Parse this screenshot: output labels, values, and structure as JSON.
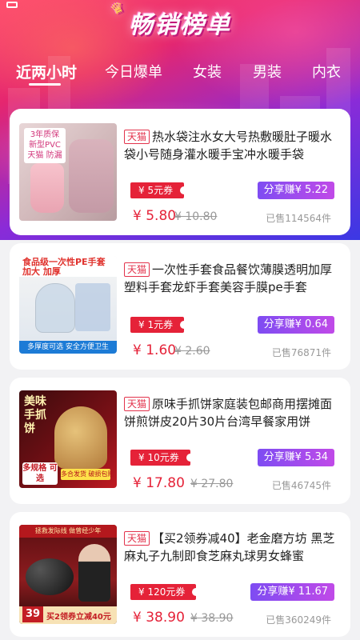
{
  "header": {
    "title": "畅销榜单"
  },
  "tabs": [
    {
      "label": "近两小时",
      "active": true
    },
    {
      "label": "今日爆单",
      "active": false
    },
    {
      "label": "女装",
      "active": false
    },
    {
      "label": "男装",
      "active": false
    },
    {
      "label": "内衣",
      "active": false
    }
  ],
  "products": [
    {
      "platform": "天猫",
      "title": "热水袋注水女大号热敷暖肚子暖水袋小号随身灌水暖手宝冲水暖手袋",
      "coupon": "¥ 5元券",
      "share": "分享赚¥ 5.22",
      "price": "¥ 5.80",
      "original_price": "¥ 10.80",
      "sold": "已售114564件",
      "thumb": {
        "badge_line1": "3年质保",
        "badge_line2": "新型PVC",
        "badge_line3": "天猫 防漏"
      }
    },
    {
      "platform": "天猫",
      "title": "一次性手套食品餐饮薄膜透明加厚塑料手套龙虾手套美容手膜pe手套",
      "coupon": "¥ 1元券",
      "share": "分享赚¥ 0.64",
      "price": "¥ 1.60",
      "original_price": "¥ 2.60",
      "sold": "已售76871件",
      "thumb": {
        "header": "食品级一次性PE手套 加大 加厚",
        "footer": "多厚度可选 安全方便卫生"
      }
    },
    {
      "platform": "天猫",
      "title": "原味手抓饼家庭装包邮商用摆摊面饼煎饼皮20片30片台湾早餐家用饼",
      "coupon": "¥ 10元券",
      "share": "分享赚¥ 5.34",
      "price": "¥ 17.80",
      "original_price": "¥ 27.80",
      "sold": "已售46745件",
      "thumb": {
        "vertical": "美味手抓饼",
        "multi": "多规格 可选",
        "tag": "多合发货 破损包赔"
      }
    },
    {
      "platform": "天猫",
      "title": "【买2领券减40】老金磨方坊 黑芝麻丸子九制即食芝麻丸球男女蜂蜜",
      "coupon": "¥ 120元券",
      "share": "分享赚¥ 11.67",
      "price": "¥ 38.90",
      "original_price": "¥ 38.90",
      "sold": "已售360249件",
      "thumb": {
        "top": "拯救发际线 做曾经少年",
        "number": "39",
        "promo": "买2领券立减40元"
      }
    }
  ],
  "colors": {
    "accent_red": "#e52238",
    "share_purple": "#9a4bee",
    "tab_text": "#ffffff"
  }
}
